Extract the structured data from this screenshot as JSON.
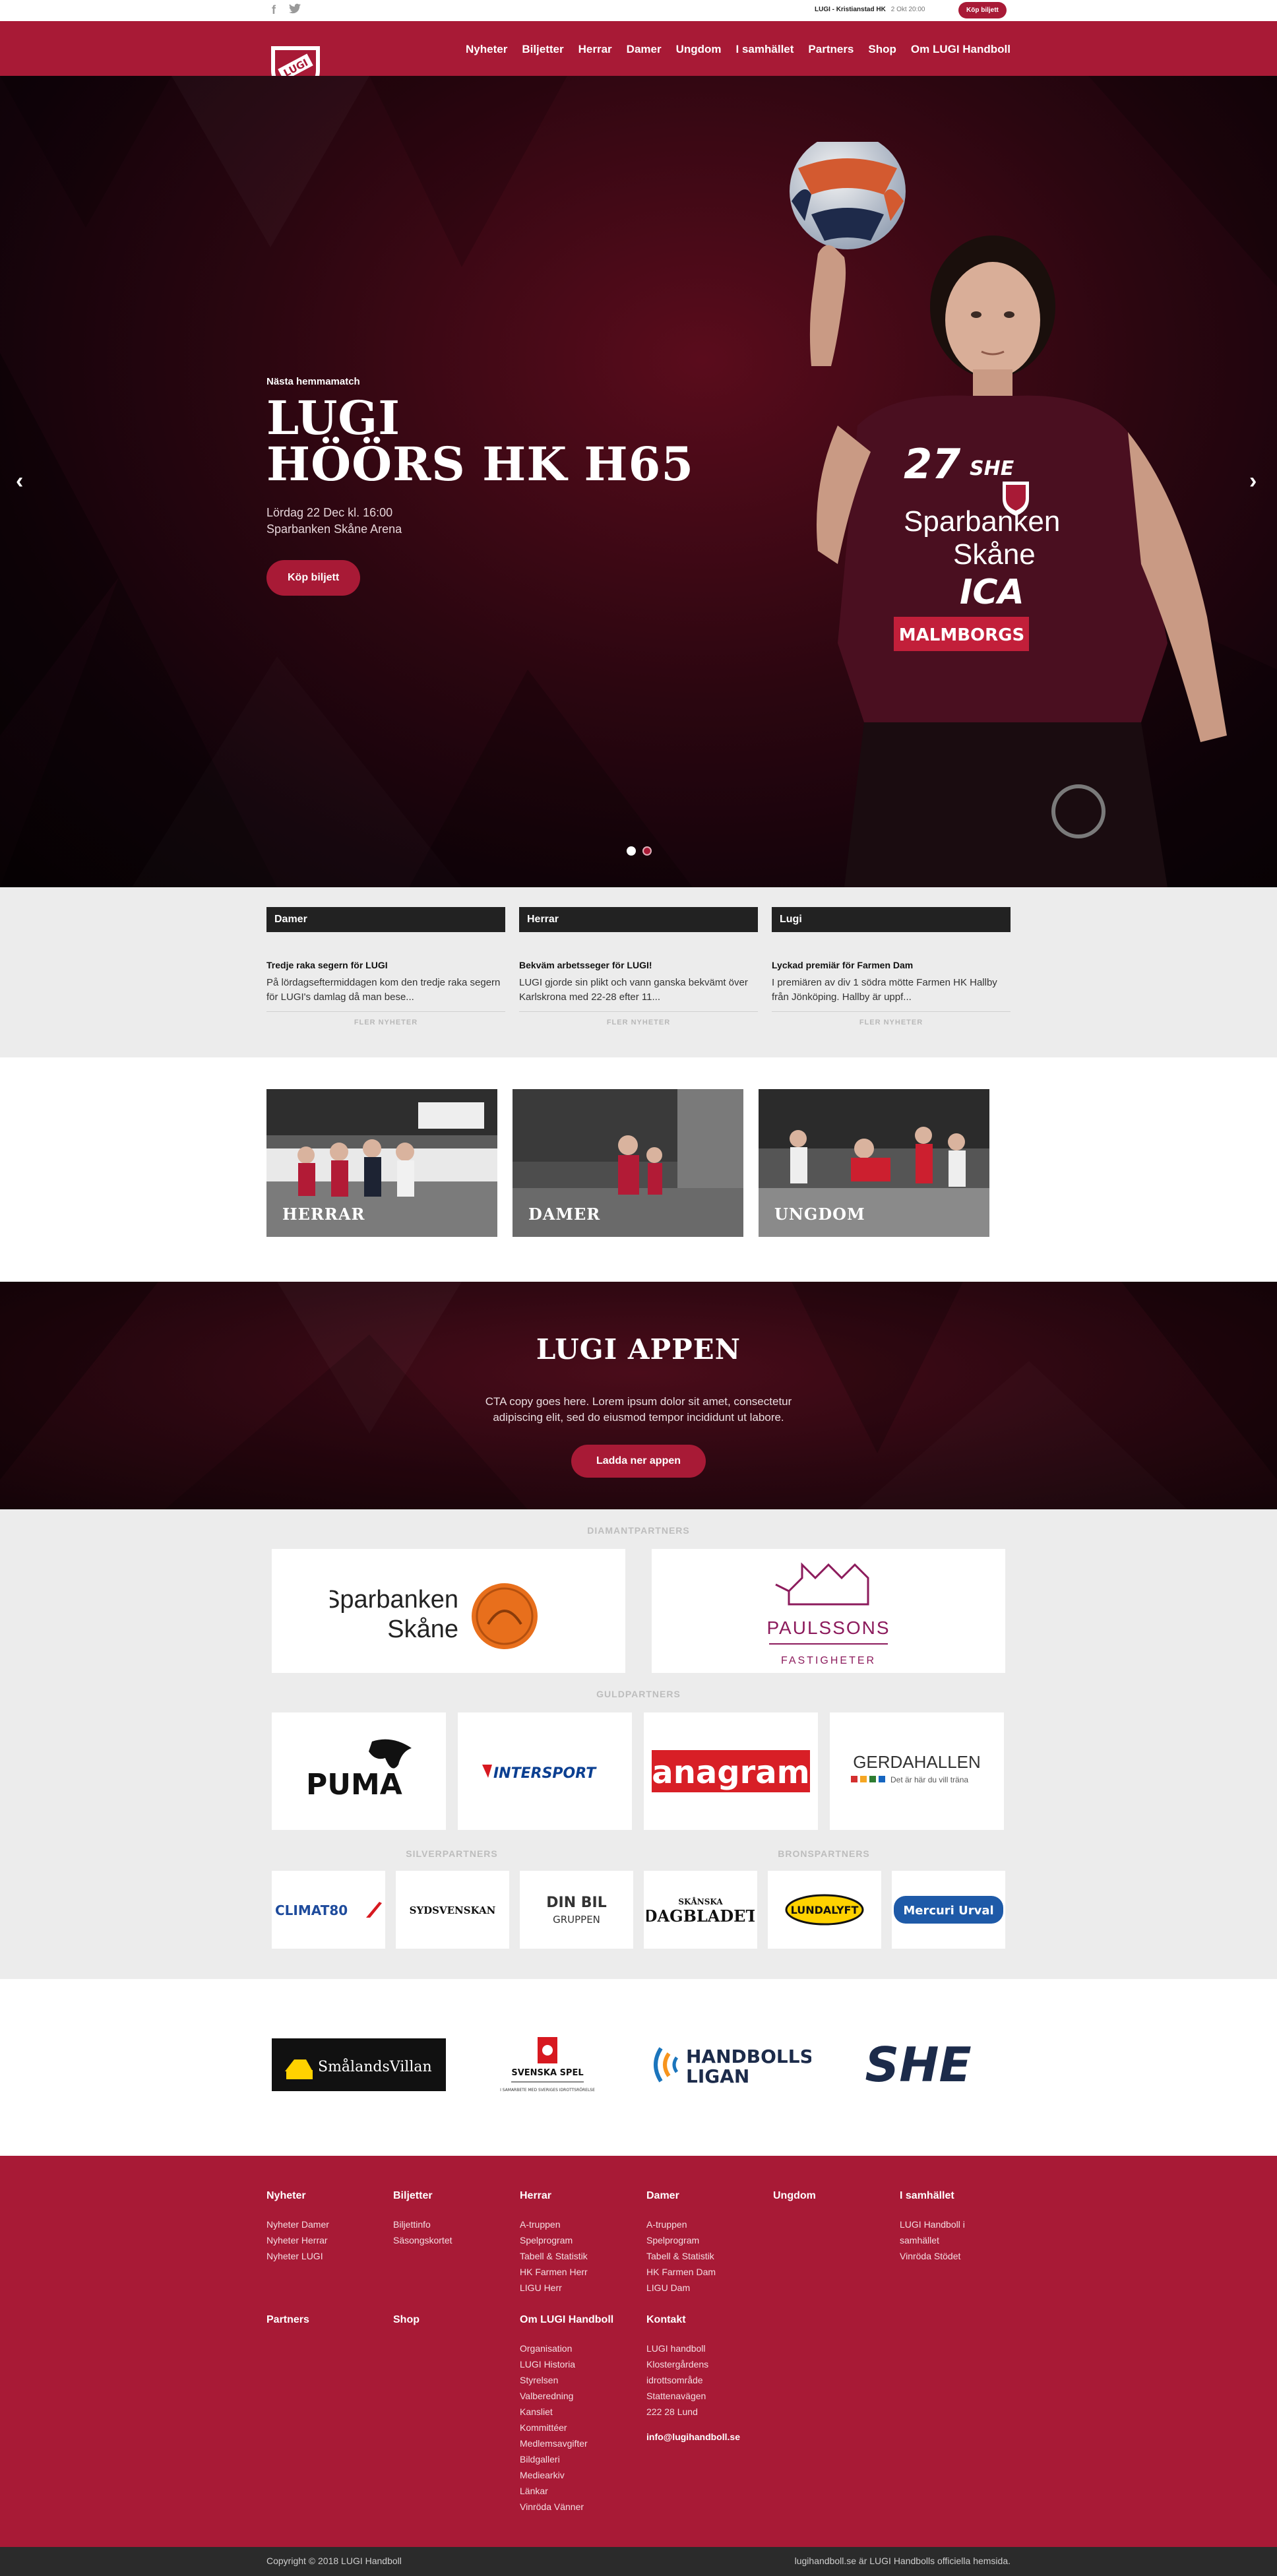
{
  "topbar": {
    "social": [
      "facebook-icon",
      "twitter-icon"
    ],
    "next_game": "LUGI - Kristianstad HK",
    "next_game_time": "2 Okt 20:00",
    "buy_label": "Köp biljett"
  },
  "header": {
    "logo_text": "LUGI",
    "nav": [
      "Nyheter",
      "Biljetter",
      "Herrar",
      "Damer",
      "Ungdom",
      "I samhället",
      "Partners",
      "Shop",
      "Om LUGI Handboll"
    ]
  },
  "hero": {
    "eyebrow": "Nästa hemmamatch",
    "title_line1": "LUGI",
    "title_line2": "HÖÖRS HK H65",
    "date": "Lördag 22 Dec kl. 16:00",
    "venue": "Sparbanken Skåne Arena",
    "button": "Köp biljett",
    "jersey_sponsor_1": "Sparbanken",
    "jersey_sponsor_2": "Skåne",
    "jersey_ica": "ICA",
    "jersey_malmborgs": "MALMBORGS",
    "jersey_number": "27",
    "jersey_she": "SHE",
    "slide_count": 2,
    "active_slide": 1
  },
  "news": [
    {
      "category": "Damer",
      "title": "Tredje raka segern för LUGI",
      "excerpt": "På lördagseftermiddagen kom den tredje raka segern för LUGI's damlag då man bese...",
      "more": "FLER NYHETER"
    },
    {
      "category": "Herrar",
      "title": "Bekväm arbetsseger för LUGI!",
      "excerpt": "LUGI gjorde sin plikt och vann ganska bekvämt över Karlskrona med 22-28 efter 11...",
      "more": "FLER NYHETER"
    },
    {
      "category": "Lugi",
      "title": "Lyckad premiär för Farmen Dam",
      "excerpt": "I premiären av div 1 södra mötte Farmen HK Hallby från Jönköping. Hallby är uppf...",
      "more": "FLER NYHETER"
    }
  ],
  "teams": [
    "HERRAR",
    "DAMER",
    "UNGDOM"
  ],
  "app_cta": {
    "title": "LUGI APPEN",
    "copy": "CTA copy goes here. Lorem ipsum dolor sit amet, consectetur adipiscing elit, sed do eiusmod tempor incididunt ut labore.",
    "button": "Ladda ner appen"
  },
  "partners": {
    "diamond_label": "DIAMANTPARTNERS",
    "gold_label": "GULDPARTNERS",
    "silver_label": "SILVERPARTNERS",
    "bronze_label": "BRONSPARTNERS",
    "diamond": {
      "sparbanken_1": "Sparbanken",
      "sparbanken_2": "Skåne",
      "paulssons": "PAULSSONS",
      "paulssons_sub": "FASTIGHETER"
    },
    "gold": {
      "puma": "PUMA",
      "intersport": "INTERSPORT",
      "anagram": "anagram",
      "gerdahallen": "GERDAHALLEN",
      "gerdahallen_sub": "Det är här du vill träna"
    },
    "silver": {
      "climat": "CLIMAT80",
      "sydsvenskan": "SYDSVENSKAN",
      "dinbil_1": "DIN BIL",
      "dinbil_2": "GRUPPEN"
    },
    "bronze": {
      "dagbladet_1": "SKÅNSKA",
      "dagbladet_2": "DAGBLADET",
      "lundalyft": "LUNDALYFT",
      "mercuri": "Mercuri Urval"
    }
  },
  "sponsors": {
    "smalandsvillan": "SmålandsVillan",
    "svenskaspel": "SVENSKA SPEL",
    "svenskaspel_sub": "I SAMARBETE MED SVERIGES IDROTTSRÖRELSE",
    "handbollsligan_1": "HANDBOLLS",
    "handbollsligan_2": "LIGAN",
    "she": "SHE"
  },
  "footer": {
    "col_nyheter": {
      "title": "Nyheter",
      "links": [
        "Nyheter Damer",
        "Nyheter Herrar",
        "Nyheter LUGI"
      ]
    },
    "col_biljetter": {
      "title": "Biljetter",
      "links": [
        "Biljettinfo",
        "Säsongskortet"
      ]
    },
    "col_herrar": {
      "title": "Herrar",
      "links": [
        "A-truppen",
        "Spelprogram",
        "Tabell & Statistik",
        "HK Farmen Herr",
        "LIGU Herr"
      ]
    },
    "col_damer": {
      "title": "Damer",
      "links": [
        "A-truppen",
        "Spelprogram",
        "Tabell & Statistik",
        "HK Farmen Dam",
        "LIGU Dam"
      ]
    },
    "col_ungdom": {
      "title": "Ungdom",
      "links": []
    },
    "col_samhallet": {
      "title": "I samhället",
      "links": [
        "LUGI Handboll i",
        "samhället",
        "Vinröda Stödet"
      ]
    },
    "col_partners": {
      "title": "Partners",
      "links": []
    },
    "col_shop": {
      "title": "Shop",
      "links": []
    },
    "col_om": {
      "title": "Om LUGI Handboll",
      "links": [
        "Organisation",
        "LUGI Historia",
        "Styrelsen",
        "Valberedning",
        "Kansliet",
        "Kommittéer",
        "Medlemsavgifter",
        "Bildgalleri",
        "Mediearkiv",
        "Länkar",
        "Vinröda Vänner"
      ]
    },
    "col_kontakt": {
      "title": "Kontakt",
      "lines": [
        "LUGI handboll",
        "Klostergårdens",
        "idrottsområde",
        "Stattenavägen",
        "222 28 Lund"
      ],
      "email": "info@lugihandboll.se"
    }
  },
  "bottombar": {
    "copyright": "Copyright © 2018 LUGI Handboll",
    "tagline": "lugihandboll.se är LUGI Handbolls officiella hemsida."
  },
  "colors": {
    "brand": "#a81a36",
    "dark": "#222222",
    "light_bg": "#ececec"
  }
}
